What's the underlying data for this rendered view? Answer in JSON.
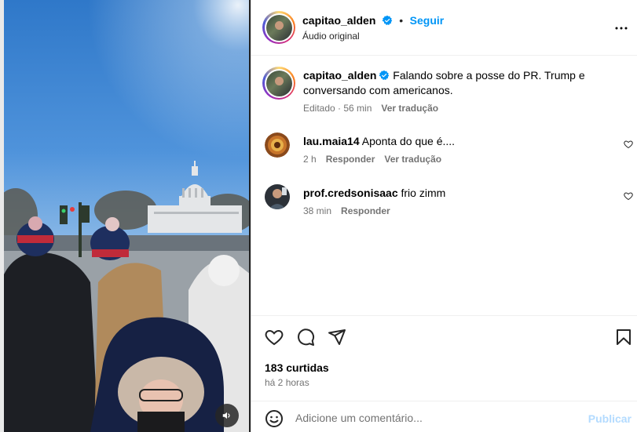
{
  "post": {
    "author": "capitao_alden",
    "follow_label": "Seguir",
    "separator": "•",
    "audio_label": "Áudio original",
    "more_icon": "more-horizontal-icon"
  },
  "caption": {
    "author": "capitao_alden",
    "text": "Falando sobre a posse do PR. Trump e conversando com americanos.",
    "edited": "Editado · 56 min",
    "translate": "Ver tradução"
  },
  "comments": [
    {
      "user": "lau.maia14",
      "text": "Aponta do que é....",
      "time": "2 h",
      "reply": "Responder",
      "translate": "Ver tradução"
    },
    {
      "user": "prof.credsonisaac",
      "text": "frio zimm",
      "time": "38 min",
      "reply": "Responder"
    }
  ],
  "stats": {
    "likes": "183 curtidas",
    "time_ago": "há 2 horas"
  },
  "comment_box": {
    "placeholder": "Adicione um comentário...",
    "post_label": "Publicar"
  },
  "colors": {
    "accent": "#0095f6",
    "verified": "#0095f6",
    "post_disabled": "#b3dbff"
  }
}
